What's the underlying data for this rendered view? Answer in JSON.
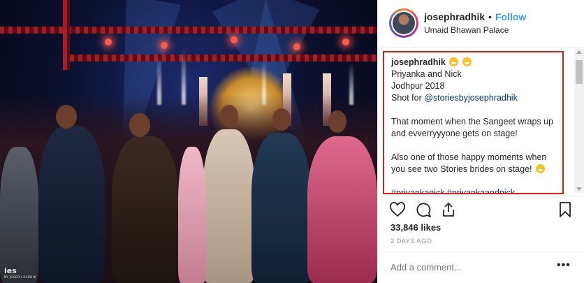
{
  "post": {
    "photo_alt": "Wedding sangeet stage photo",
    "watermark": "ies",
    "watermark_sub": "BY JOSEPH RADHIK"
  },
  "header": {
    "username": "josephradhik",
    "separator": "•",
    "follow_label": "Follow",
    "location": "Umaid Bhawan Palace"
  },
  "caption": {
    "user": "josephradhik",
    "lines": [
      "Priyanka and Nick",
      "Jodhpur 2018",
      "Shot for ",
      "That moment when the Sangeet wraps up",
      "and evverryyyone gets on stage!",
      "Also one of those happy moments when",
      "you see two Stories brides on stage! ",
      "#priyankanick #priyankaandnick"
    ],
    "mention": "@storiesbyjosephradhik"
  },
  "actions": {
    "like_icon": "heart-icon",
    "comment_icon": "comment-icon",
    "share_icon": "share-icon",
    "save_icon": "bookmark-icon"
  },
  "stats": {
    "likes": "33,846 likes",
    "timestamp": "2 DAYS AGO"
  },
  "comment": {
    "placeholder": "Add a comment...",
    "more_label": "•••"
  },
  "colors": {
    "accent": "#3897f0",
    "highlight_border": "#e01b1b",
    "link": "#003569"
  }
}
